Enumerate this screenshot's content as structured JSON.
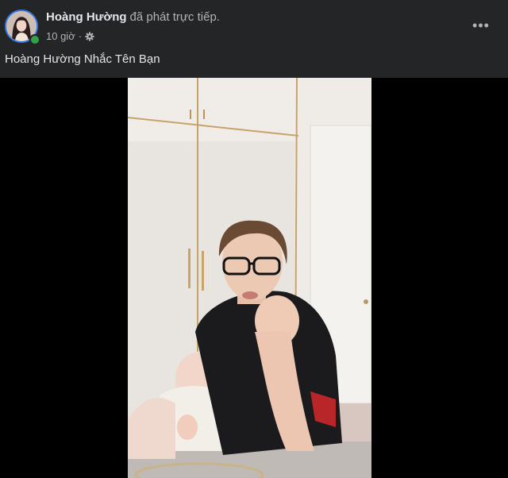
{
  "post": {
    "author": "Hoàng Hường",
    "action": "đã phát trực tiếp.",
    "time": "10 giờ",
    "privacy_icon": "gear-icon",
    "more_icon": "more-options-icon",
    "more_label": "•••",
    "caption": "Hoàng Hường Nhắc Tên Bạn"
  },
  "colors": {
    "background": "#242526",
    "text": "#e4e6eb",
    "secondary_text": "#b0b3b8",
    "online": "#31a24c",
    "avatar_ring": "#3578e5"
  }
}
